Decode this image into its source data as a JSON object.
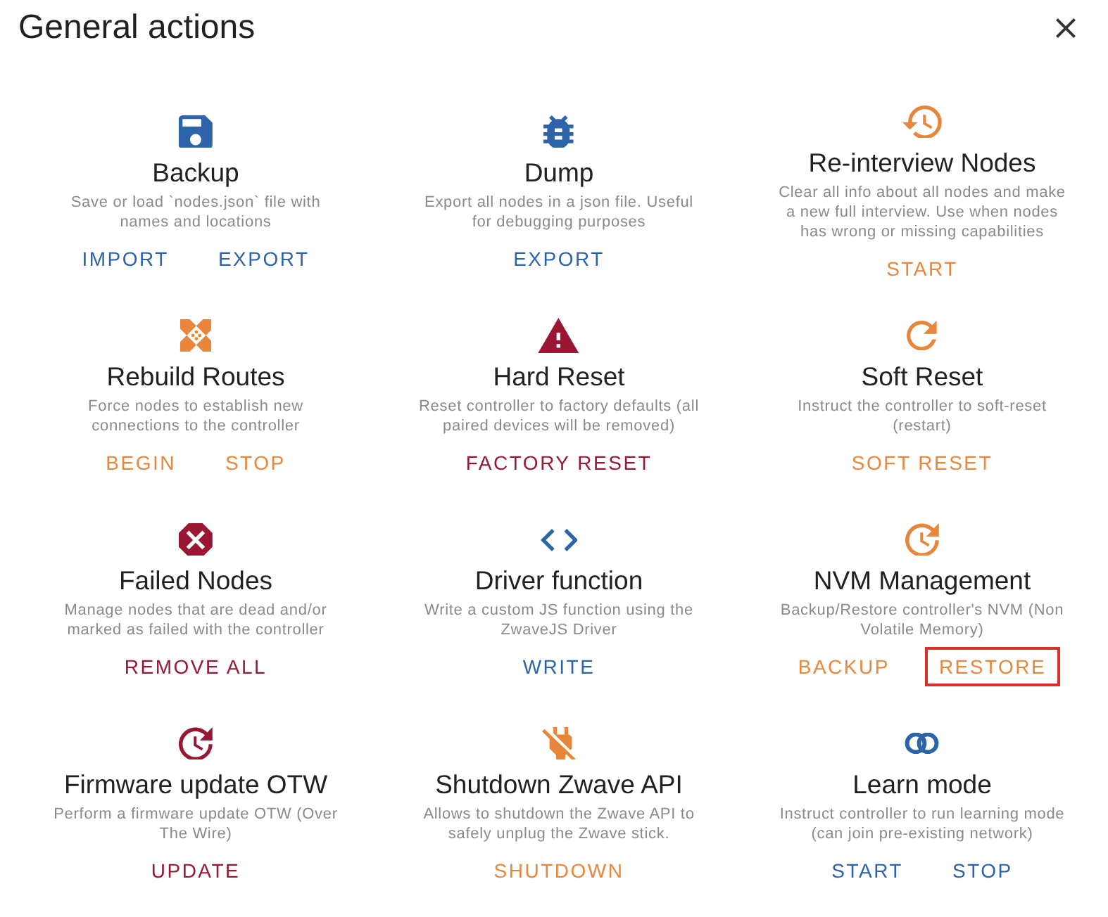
{
  "dialog": {
    "title": "General actions"
  },
  "rows": [
    {
      "cards": [
        {
          "color": "#2c63a9",
          "title": "Backup",
          "description": "Save or load `nodes.json` file with names and locations",
          "actions": [
            {
              "label": "IMPORT",
              "highlighted": false
            },
            {
              "label": "EXPORT",
              "highlighted": false
            }
          ]
        },
        {
          "color": "#2c63a9",
          "title": "Dump",
          "description": "Export all nodes in a json file. Useful for debugging purposes",
          "actions": [
            {
              "label": "EXPORT",
              "highlighted": false
            }
          ]
        },
        {
          "color": "#e8863c",
          "title": "Re-interview Nodes",
          "description": "Clear all info about all nodes and make a new full interview. Use when nodes has wrong or missing capabilities",
          "actions": [
            {
              "label": "START",
              "highlighted": false
            }
          ]
        }
      ]
    },
    {
      "cards": [
        {
          "color": "#e8863c",
          "title": "Rebuild Routes",
          "description": "Force nodes to establish new connections to the controller",
          "actions": [
            {
              "label": "BEGIN",
              "highlighted": false
            },
            {
              "label": "STOP",
              "highlighted": false
            }
          ]
        },
        {
          "color": "#9a1733",
          "title": "Hard Reset",
          "description": "Reset controller to factory defaults (all paired devices will be removed)",
          "actions": [
            {
              "label": "FACTORY RESET",
              "highlighted": false
            }
          ]
        },
        {
          "color": "#e8863c",
          "title": "Soft Reset",
          "description": "Instruct the controller to soft-reset (restart)",
          "actions": [
            {
              "label": "SOFT RESET",
              "highlighted": false
            }
          ]
        }
      ]
    },
    {
      "cards": [
        {
          "color": "#9a1733",
          "title": "Failed Nodes",
          "description": "Manage nodes that are dead and/or marked as failed with the controller",
          "actions": [
            {
              "label": "REMOVE ALL",
              "highlighted": false
            }
          ]
        },
        {
          "color": "#2c63a9",
          "title": "Driver function",
          "description": "Write a custom JS function using the ZwaveJS Driver",
          "actions": [
            {
              "label": "WRITE",
              "highlighted": false
            }
          ]
        },
        {
          "color": "#e8863c",
          "title": "NVM Management",
          "description": "Backup/Restore controller's NVM (Non Volatile Memory)",
          "actions": [
            {
              "label": "BACKUP",
              "highlighted": false
            },
            {
              "label": "RESTORE",
              "highlighted": true
            }
          ]
        }
      ]
    },
    {
      "cards": [
        {
          "color": "#9a1733",
          "title": "Firmware update OTW",
          "description": "Perform a firmware update OTW (Over The Wire)",
          "actions": [
            {
              "label": "UPDATE",
              "highlighted": false
            }
          ]
        },
        {
          "color": "#e8863c",
          "title": "Shutdown Zwave API",
          "description": "Allows to shutdown the Zwave API to safely unplug the Zwave stick.",
          "actions": [
            {
              "label": "SHUTDOWN",
              "highlighted": false
            }
          ]
        },
        {
          "color": "#2c63a9",
          "title": "Learn mode",
          "description": "Instruct controller to run learning mode (can join pre-existing network)",
          "actions": [
            {
              "label": "START",
              "highlighted": false
            },
            {
              "label": "STOP",
              "highlighted": false
            }
          ]
        }
      ]
    }
  ]
}
